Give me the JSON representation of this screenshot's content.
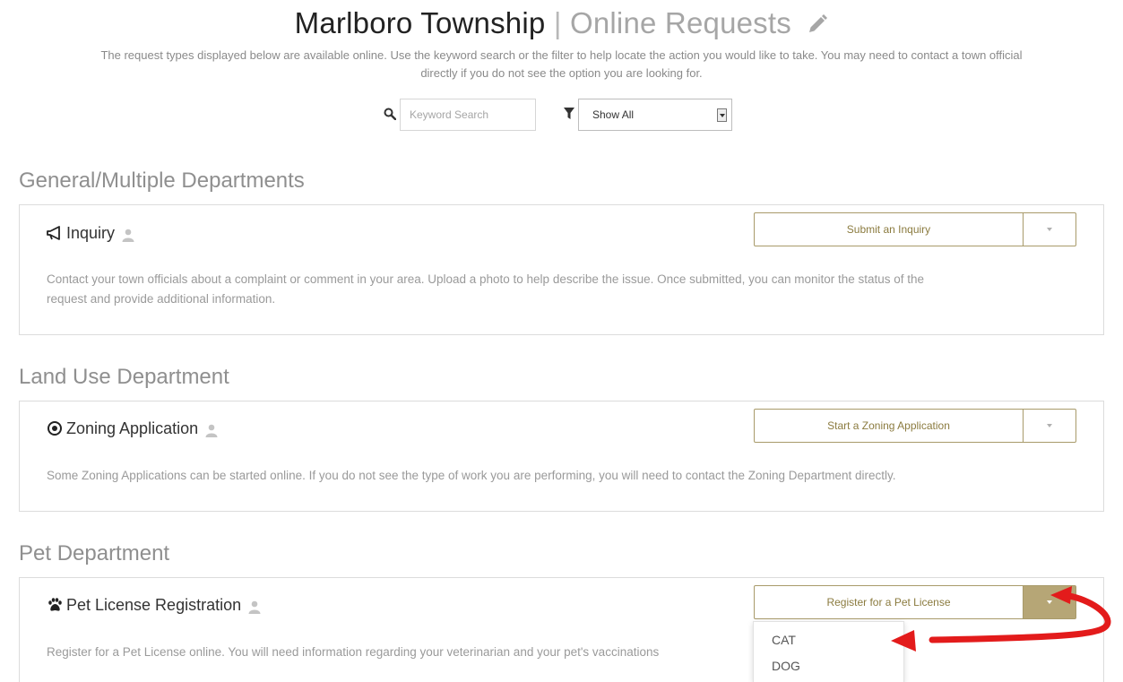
{
  "header": {
    "title_main": "Marlboro Township",
    "title_separator": "|",
    "title_sub": "Online Requests",
    "edit_icon": "pencil-icon",
    "intro_line1": "The request types displayed below are available online. Use the keyword search or the filter to help locate the action you would like to take. You may need to contact a town official",
    "intro_line2": "directly if you do not see the option you are looking for."
  },
  "search": {
    "icon": "search-icon",
    "placeholder": "Keyword Search",
    "value": ""
  },
  "filter": {
    "icon": "filter-icon",
    "selected": "Show All"
  },
  "sections": [
    {
      "heading": "General/Multiple Departments",
      "card": {
        "icon": "megaphone-icon",
        "title": "Inquiry",
        "button_label": "Submit an Inquiry",
        "description_line1": "Contact your town officials about a complaint or comment in your area. Upload a photo to help describe the issue. Once submitted, you can monitor the status of the",
        "description_line2": "request and provide additional information."
      }
    },
    {
      "heading": "Land Use Department",
      "card": {
        "icon": "target-icon",
        "title": "Zoning Application",
        "button_label": "Start a Zoning Application",
        "description_line1": "Some Zoning Applications can be started online. If you do not see the type of work you are performing, you will need to contact the Zoning Department directly."
      }
    },
    {
      "heading": "Pet Department",
      "card": {
        "icon": "paw-icon",
        "title": "Pet License Registration",
        "button_label": "Register for a Pet License",
        "description_line1": "Register for a Pet License online. You will need information regarding your veterinarian and your pet's vaccinations",
        "dropdown_items": [
          "CAT",
          "DOG"
        ]
      }
    }
  ],
  "colors": {
    "accent": "#b6a676",
    "accent_text": "#8b7b3f",
    "annotation": "#e31b1b"
  }
}
